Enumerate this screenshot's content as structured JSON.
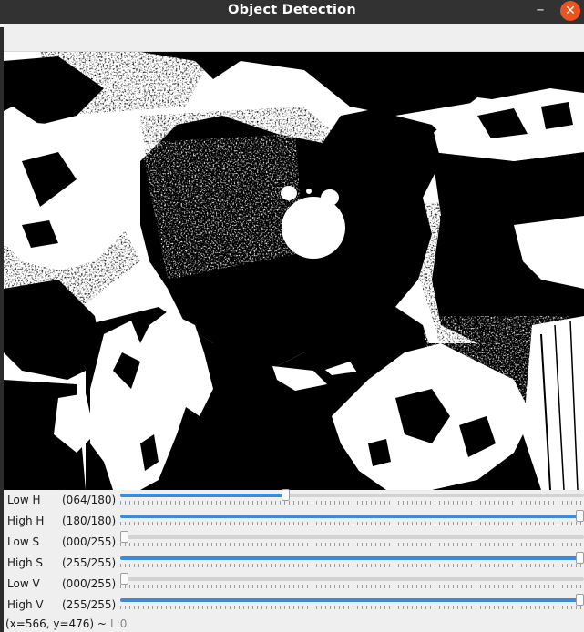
{
  "window": {
    "title": "Object Detection",
    "minimize_icon": "minimize-icon",
    "close_icon": "close-icon"
  },
  "image": {
    "description_kind": "binary threshold mask",
    "colors": {
      "foreground": "#000000",
      "background": "#ffffff"
    }
  },
  "trackbars": [
    {
      "label": "Low H",
      "display": "(064/180)",
      "value": 64,
      "max": 180
    },
    {
      "label": "High H",
      "display": "(180/180)",
      "value": 180,
      "max": 180
    },
    {
      "label": "Low S",
      "display": "(000/255)",
      "value": 0,
      "max": 255
    },
    {
      "label": "High S",
      "display": "(255/255)",
      "value": 255,
      "max": 255
    },
    {
      "label": "Low V",
      "display": "(000/255)",
      "value": 0,
      "max": 255
    },
    {
      "label": "High V",
      "display": "(255/255)",
      "value": 255,
      "max": 255
    }
  ],
  "status": {
    "coords": "(x=566, y=476) ~",
    "level": "L:0"
  },
  "colors": {
    "titlebar": "#323232",
    "close_button": "#e9541f",
    "trackbar_fill": "#3d8ad6"
  }
}
